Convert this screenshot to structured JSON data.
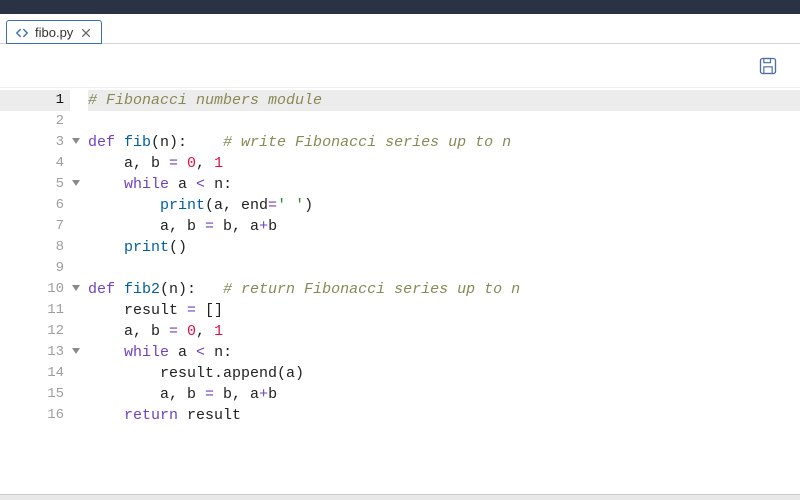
{
  "tab": {
    "filename": "fibo.py",
    "close_label": "×"
  },
  "toolbar": {
    "save_title": "Save"
  },
  "active_line": 1,
  "fold_lines": [
    3,
    5,
    10,
    13
  ],
  "lines": [
    {
      "n": 1,
      "tokens": [
        {
          "t": "# Fibonacci numbers module",
          "c": "comment"
        }
      ]
    },
    {
      "n": 2,
      "tokens": []
    },
    {
      "n": 3,
      "tokens": [
        {
          "t": "def ",
          "c": "kw"
        },
        {
          "t": "fib",
          "c": "def"
        },
        {
          "t": "(n):    ",
          "c": "name"
        },
        {
          "t": "# write Fibonacci series up to n",
          "c": "comment"
        }
      ]
    },
    {
      "n": 4,
      "tokens": [
        {
          "t": "    a, b ",
          "c": "name"
        },
        {
          "t": "= ",
          "c": "op"
        },
        {
          "t": "0",
          "c": "num"
        },
        {
          "t": ", ",
          "c": "name"
        },
        {
          "t": "1",
          "c": "num"
        }
      ]
    },
    {
      "n": 5,
      "tokens": [
        {
          "t": "    ",
          "c": "name"
        },
        {
          "t": "while ",
          "c": "kw"
        },
        {
          "t": "a ",
          "c": "name"
        },
        {
          "t": "< ",
          "c": "op"
        },
        {
          "t": "n:",
          "c": "name"
        }
      ]
    },
    {
      "n": 6,
      "tokens": [
        {
          "t": "        ",
          "c": "name"
        },
        {
          "t": "print",
          "c": "builtin"
        },
        {
          "t": "(a, end",
          "c": "name"
        },
        {
          "t": "=",
          "c": "op"
        },
        {
          "t": "' '",
          "c": "str"
        },
        {
          "t": ")",
          "c": "name"
        }
      ]
    },
    {
      "n": 7,
      "tokens": [
        {
          "t": "        a, b ",
          "c": "name"
        },
        {
          "t": "= ",
          "c": "op"
        },
        {
          "t": "b, a",
          "c": "name"
        },
        {
          "t": "+",
          "c": "op"
        },
        {
          "t": "b",
          "c": "name"
        }
      ]
    },
    {
      "n": 8,
      "tokens": [
        {
          "t": "    ",
          "c": "name"
        },
        {
          "t": "print",
          "c": "builtin"
        },
        {
          "t": "()",
          "c": "name"
        }
      ]
    },
    {
      "n": 9,
      "tokens": []
    },
    {
      "n": 10,
      "tokens": [
        {
          "t": "def ",
          "c": "kw"
        },
        {
          "t": "fib2",
          "c": "def"
        },
        {
          "t": "(n):   ",
          "c": "name"
        },
        {
          "t": "# return Fibonacci series up to n",
          "c": "comment"
        }
      ]
    },
    {
      "n": 11,
      "tokens": [
        {
          "t": "    result ",
          "c": "name"
        },
        {
          "t": "= ",
          "c": "op"
        },
        {
          "t": "[]",
          "c": "name"
        }
      ]
    },
    {
      "n": 12,
      "tokens": [
        {
          "t": "    a, b ",
          "c": "name"
        },
        {
          "t": "= ",
          "c": "op"
        },
        {
          "t": "0",
          "c": "num"
        },
        {
          "t": ", ",
          "c": "name"
        },
        {
          "t": "1",
          "c": "num"
        }
      ]
    },
    {
      "n": 13,
      "tokens": [
        {
          "t": "    ",
          "c": "name"
        },
        {
          "t": "while ",
          "c": "kw"
        },
        {
          "t": "a ",
          "c": "name"
        },
        {
          "t": "< ",
          "c": "op"
        },
        {
          "t": "n:",
          "c": "name"
        }
      ]
    },
    {
      "n": 14,
      "tokens": [
        {
          "t": "        result.append(a)",
          "c": "name"
        }
      ]
    },
    {
      "n": 15,
      "tokens": [
        {
          "t": "        a, b ",
          "c": "name"
        },
        {
          "t": "= ",
          "c": "op"
        },
        {
          "t": "b, a",
          "c": "name"
        },
        {
          "t": "+",
          "c": "op"
        },
        {
          "t": "b",
          "c": "name"
        }
      ]
    },
    {
      "n": 16,
      "tokens": [
        {
          "t": "    ",
          "c": "name"
        },
        {
          "t": "return ",
          "c": "kw"
        },
        {
          "t": "result",
          "c": "name"
        }
      ]
    }
  ]
}
